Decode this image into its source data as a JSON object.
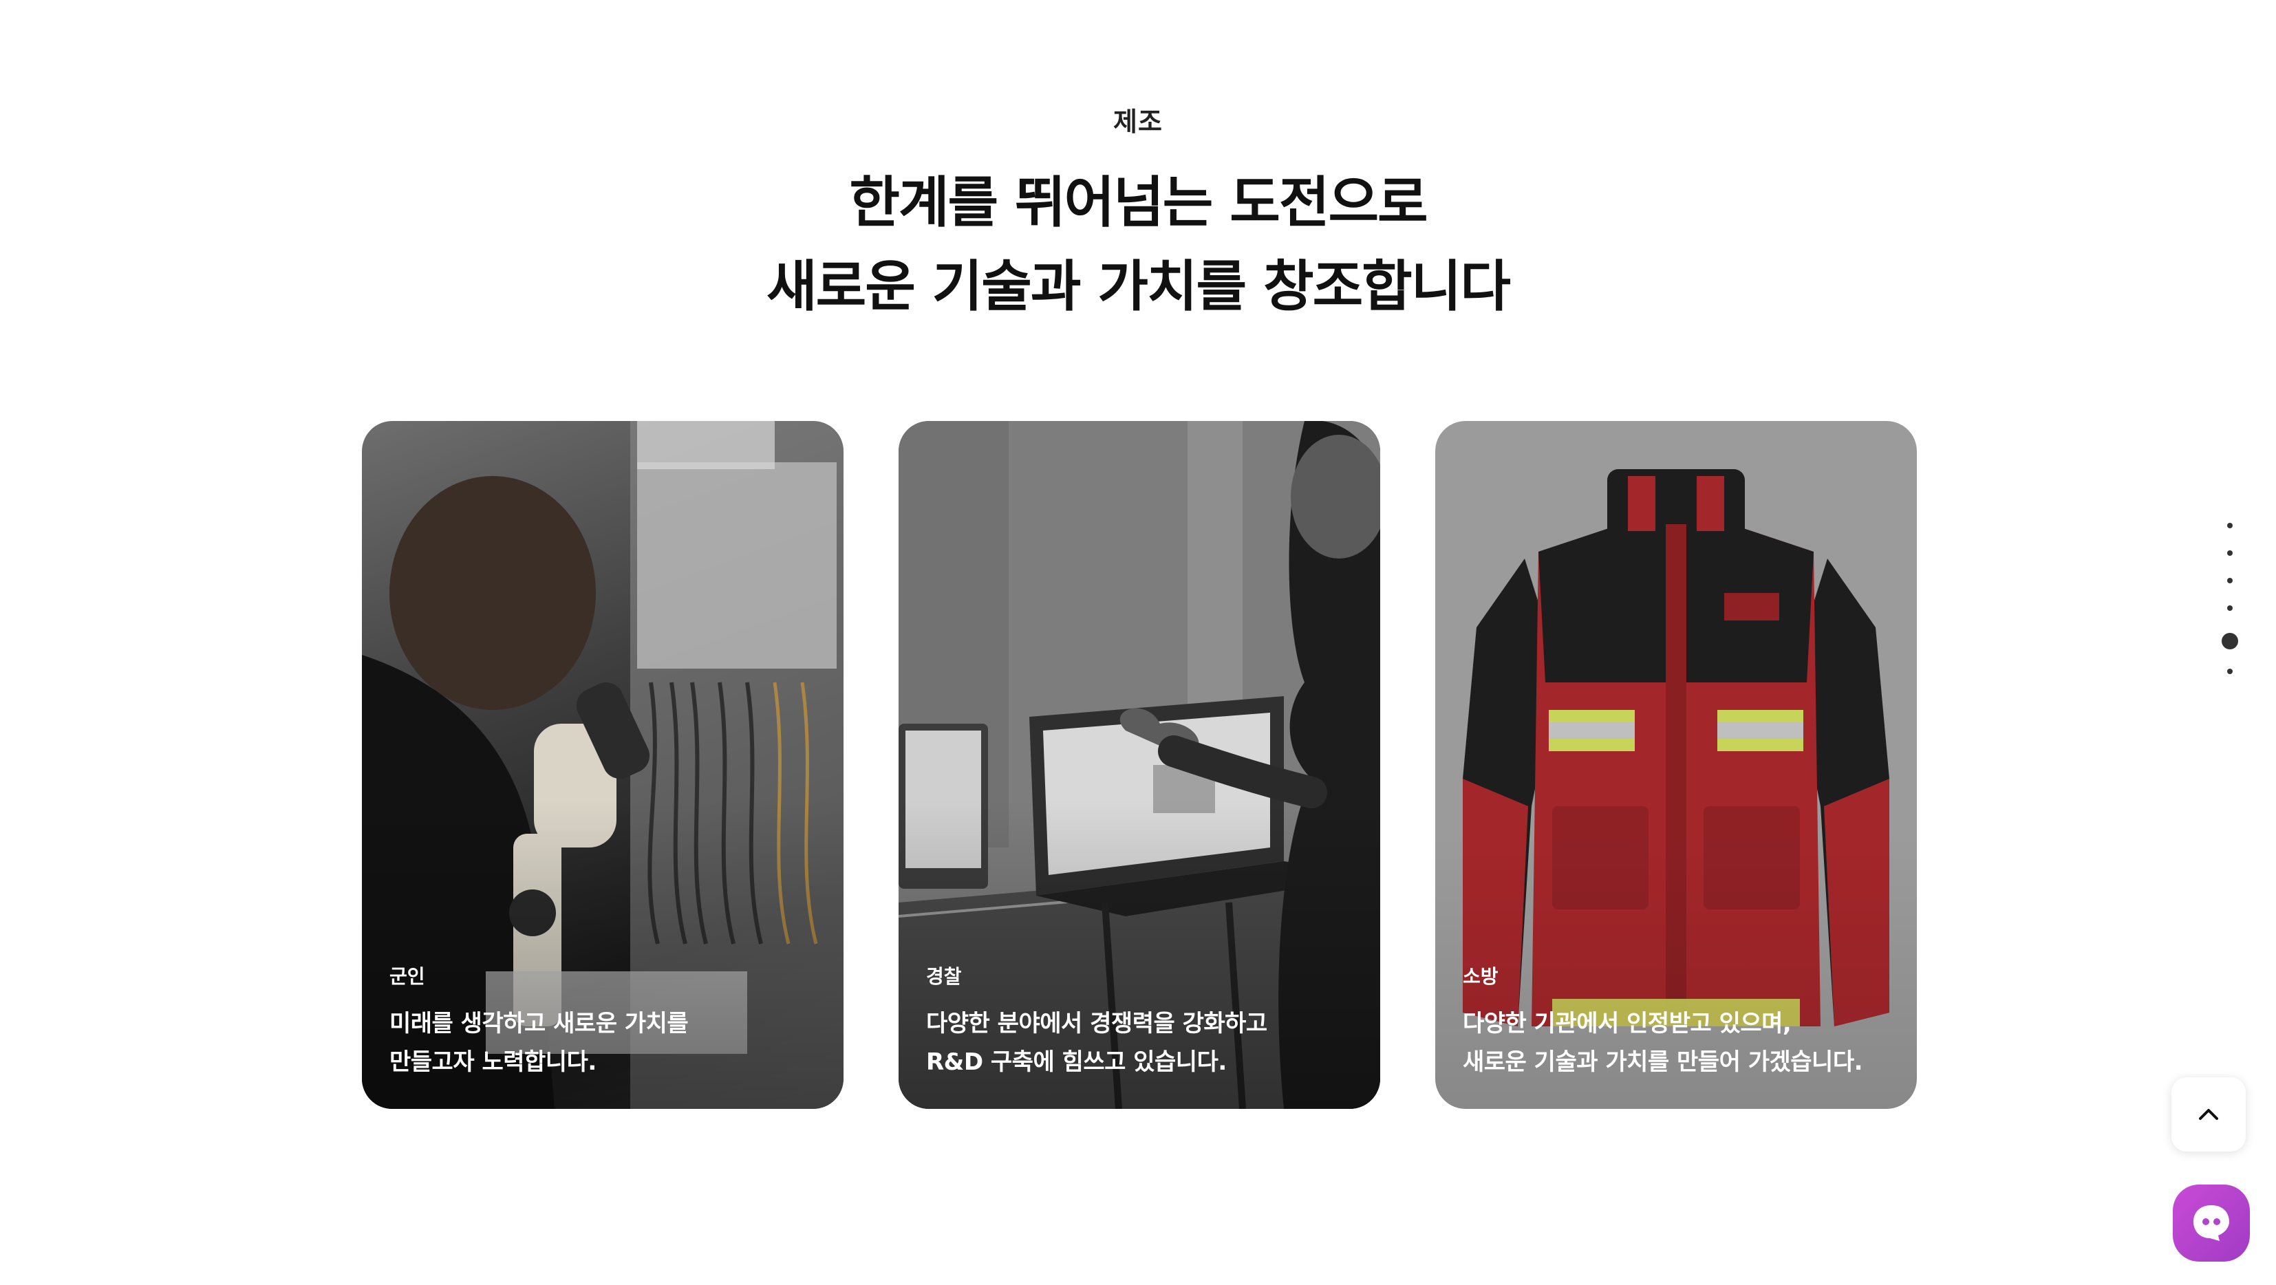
{
  "section": {
    "eyebrow": "제조",
    "headline_line1": "한계를 뛰어넘는 도전으로",
    "headline_line2": "새로운 기술과 가치를 창조합니다"
  },
  "cards": [
    {
      "category": "군인",
      "desc_line1": "미래를 생각하고 새로운 가치를",
      "desc_line2": "만들고자 노력합니다.",
      "image": "microscope-lab-photo"
    },
    {
      "category": "경찰",
      "desc_line1": "다양한 분야에서 경쟁력을 강화하고",
      "desc_line2": "R&D 구축에 힘쓰고 있습니다.",
      "image": "laptop-meeting-photo"
    },
    {
      "category": "소방",
      "desc_line1": "다양한 기관에서 인정받고 있으며,",
      "desc_line2": "새로운 기술과 가치를 만들어 가겠습니다.",
      "image": "firefighter-jacket-photo"
    }
  ],
  "pager": {
    "count": 6,
    "active_index": 4
  },
  "floating": {
    "to_top_icon": "chevron-up-icon",
    "chat_icon": "chat-bubble-icon"
  },
  "colors": {
    "accent_chat": "#b044cc",
    "jacket_red": "#a3262a",
    "reflective": "#c8d35a"
  }
}
